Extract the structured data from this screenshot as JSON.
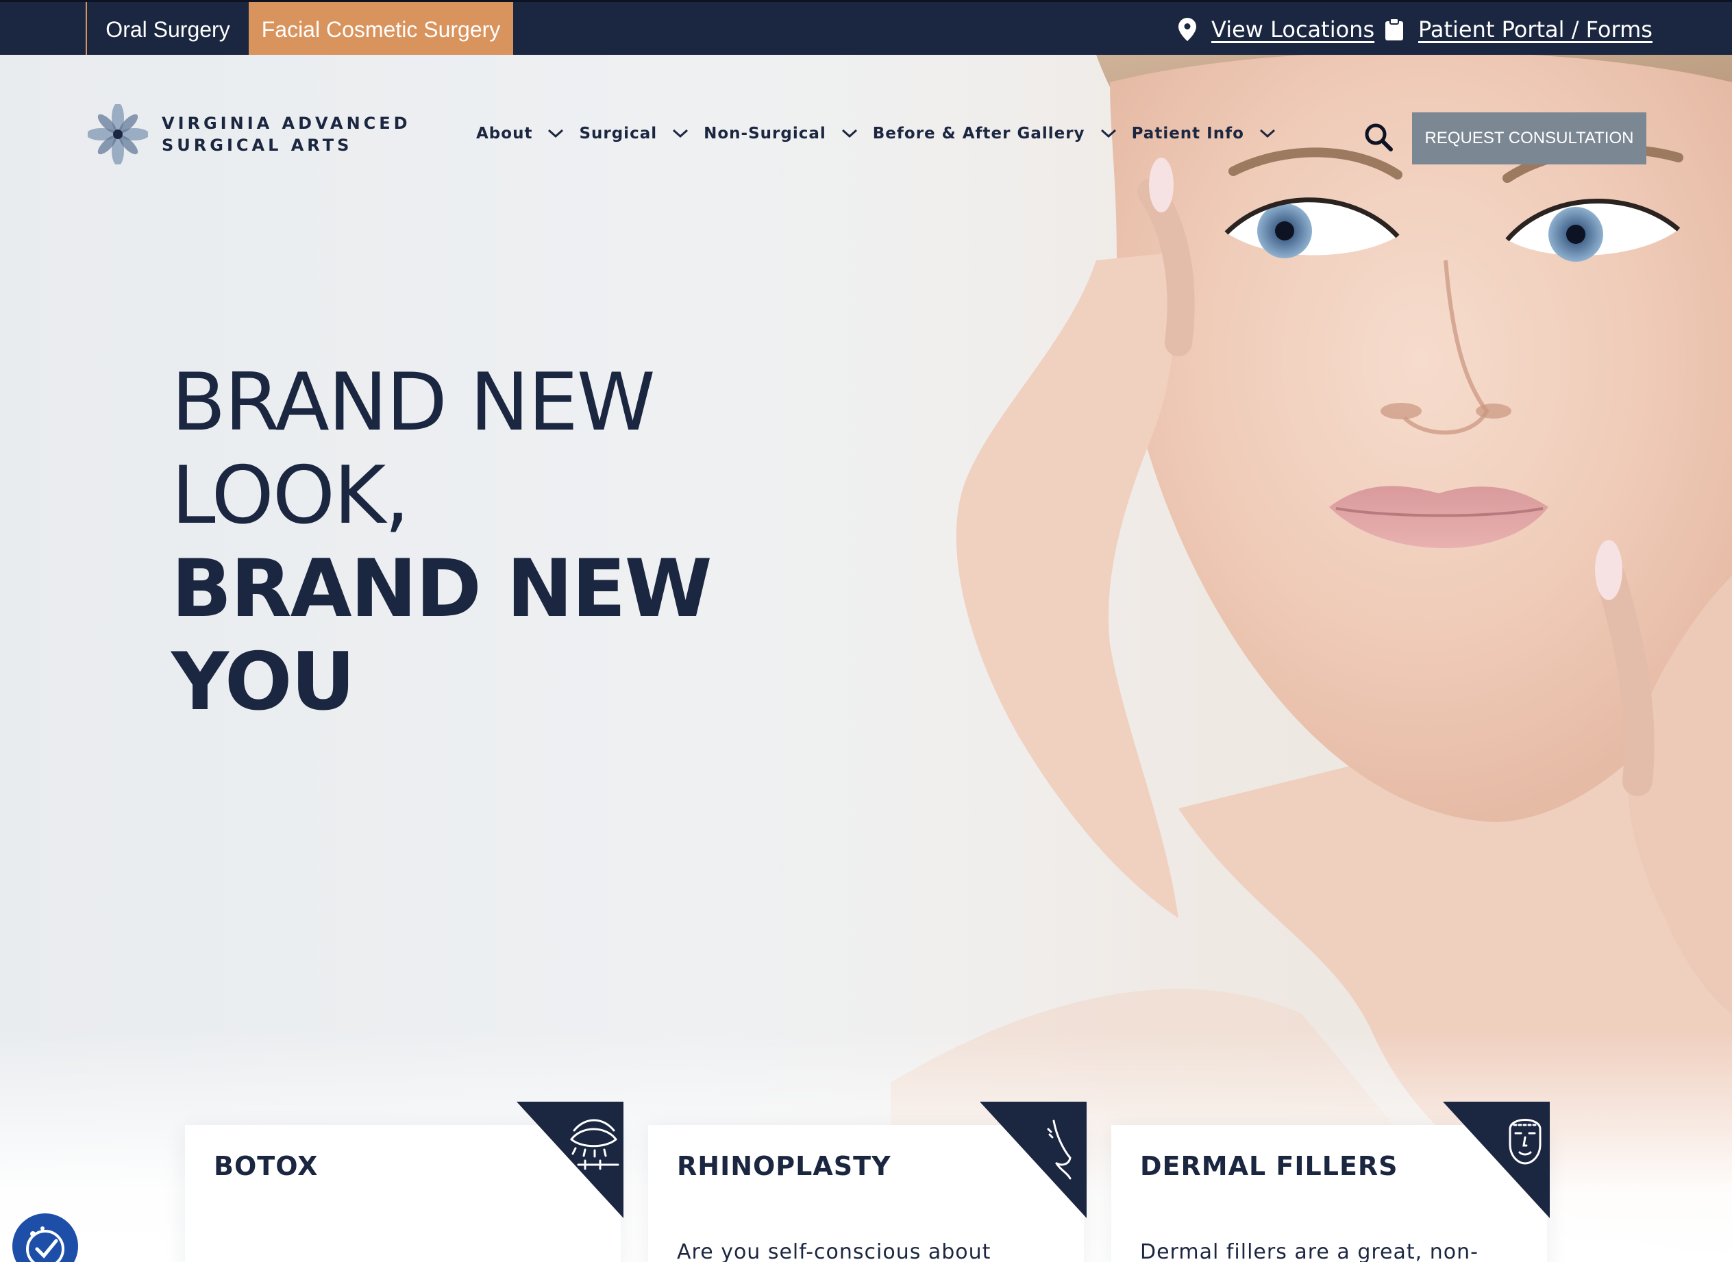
{
  "topbar": {
    "tabs": [
      {
        "label": "Oral Surgery",
        "active": false
      },
      {
        "label": "Facial Cosmetic Surgery",
        "active": true
      }
    ],
    "links": {
      "locations": "View Locations",
      "portal": "Patient Portal / Forms"
    }
  },
  "header": {
    "logo_line1": "VIRGINIA ADVANCED",
    "logo_line2": "SURGICAL ARTS",
    "nav": [
      {
        "label": "About"
      },
      {
        "label": "Surgical"
      },
      {
        "label": "Non-Surgical"
      },
      {
        "label": "Before & After Gallery"
      },
      {
        "label": "Patient Info"
      }
    ],
    "cta": "REQUEST CONSULTATION"
  },
  "hero": {
    "line1": "BRAND NEW",
    "line2": "LOOK,",
    "line3": "BRAND NEW",
    "line4": "YOU"
  },
  "cards": [
    {
      "title": "BOTOX",
      "text": "",
      "icon": "eye-syringe-icon"
    },
    {
      "title": "RHINOPLASTY",
      "text": "Are you self-conscious about",
      "icon": "nose-profile-icon"
    },
    {
      "title": "DERMAL FILLERS",
      "text": "Dermal fillers are a great, non-",
      "icon": "face-outline-icon"
    }
  ],
  "colors": {
    "navy": "#1b2640",
    "accent": "#d9935c",
    "cta": "#7c8794",
    "accessibility": "#1e4fa8"
  }
}
